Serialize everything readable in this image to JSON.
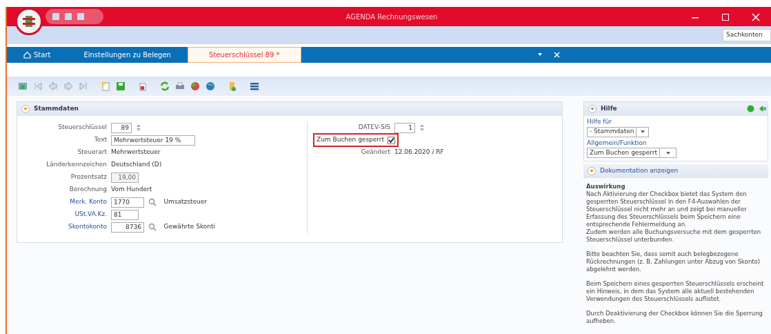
{
  "window": {
    "title": "AGENDA Rechnungswesen"
  },
  "ribbon": {
    "search_value": "Sachkonten"
  },
  "tabs": [
    {
      "label": "Start",
      "kind": "home",
      "selected": false
    },
    {
      "label": "Einstellungen zu Belegen",
      "kind": "plain",
      "selected": false
    },
    {
      "label": "Steuerschlüssel 89 *",
      "kind": "plain",
      "selected": true
    }
  ],
  "section": {
    "title": "Stammdaten",
    "expanded": true
  },
  "fields": [
    {
      "label": "Steuerschlüssel",
      "kind": "spin",
      "value": "89",
      "link": false
    },
    {
      "label": "Text",
      "kind": "input",
      "value": "Mehrwertsteuer 19 %",
      "link": false
    },
    {
      "label": "Steuerart",
      "kind": "text",
      "value": "Mehrwertsteuer",
      "link": false
    },
    {
      "label": "Länderkennzeichen",
      "kind": "text",
      "value": "Deutschland (D)",
      "link": false
    },
    {
      "label": "Prozentsatz",
      "kind": "readonly",
      "value": "19,00",
      "link": false
    },
    {
      "label": "Berechnung",
      "kind": "text",
      "value": "Vom Hundert",
      "link": false
    },
    {
      "label": "Merk. Konto",
      "kind": "lookup",
      "value": "1770",
      "description": "Umsatzsteuer",
      "link": true
    },
    {
      "label": "USt.VA.Kz.",
      "kind": "input",
      "value": "81",
      "link": true
    },
    {
      "label": "Skontokonto",
      "kind": "lookup",
      "value": "8736",
      "description": "Gewährte Skonti",
      "link": true
    }
  ],
  "right_fields": [
    {
      "label": "DATEV-SIS",
      "kind": "spin",
      "value": "1"
    },
    {
      "label": "Zum Buchen gesperrt",
      "kind": "checkbox",
      "checked": true,
      "highlighted": true
    },
    {
      "label": "Geändert",
      "kind": "text",
      "value": "12.06.2020 / RF"
    }
  ],
  "help": {
    "title": "Hilfe",
    "expanded": true,
    "help_for_label": "Hilfe für",
    "help_for_value": "- Stammdaten",
    "function_label": "Allgemein/Funktion",
    "function_value": "Zum Buchen gesperrt",
    "doc_title": "Dokumentation anzeigen",
    "heading": "Auswirkung",
    "paragraphs": [
      "Nach Aktivierung der Checkbox bietet das System den gesperrten Steuerschlüssel in den F4-Auswahlen der Steuerschlüssel nicht mehr an und zeigt bei manueller Erfassung des Steuerschlüssels beim Speichern eine entsprechende Fehlermeldung an.\nZudem werden alle Buchungsversuche mit dem gesperrten Steuerschlüssel unterbunden.",
      "Bitte beachten Sie, dass somit auch belegbezogene Rückrechnungen (z. B. Zahlungen unter Abzug von Skonto) abgelehnt werden.",
      "Beim Speichern eines gesperrten Steuerschlüssels erscheint ein Hinweis, in dem das System alle aktuell bestehenden Verwendungen des Steuerschlüssels auflistet.",
      "Durch Deaktivierung der Checkbox können Sie die Sperrung aufheben."
    ]
  }
}
